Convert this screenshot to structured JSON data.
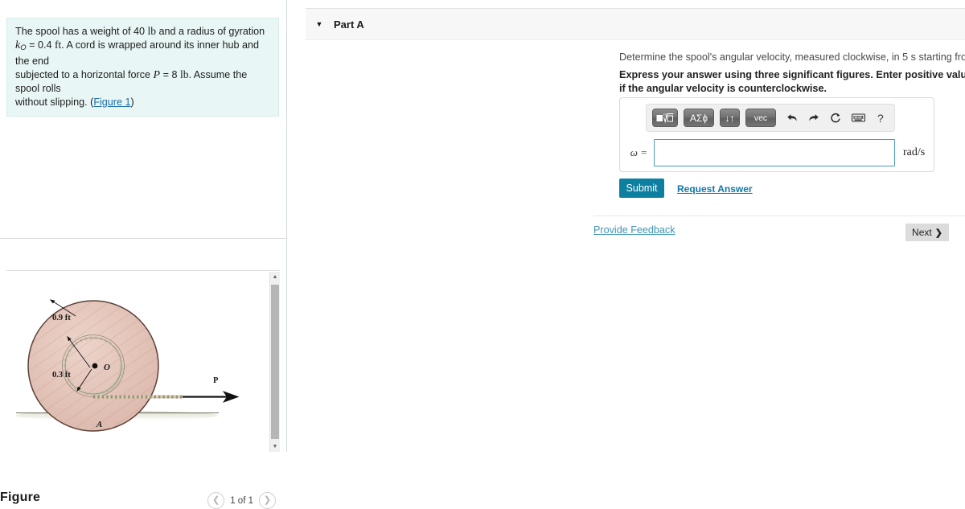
{
  "problem": {
    "line1_a": "The spool has a weight of 40",
    "line1_unit": "lb",
    "line1_b": "and a radius of gyration",
    "kvar": "k",
    "ksub": "O",
    "keq": "= 0.4",
    "kunit": "ft",
    "line2_b": ". A cord is wrapped around its inner hub and the end",
    "line3_a": "subjected to a horizontal force",
    "pvar": "P",
    "peq": "= 8",
    "punit": "lb",
    "line3_b": ". Assume the spool rolls",
    "line4_a": "without slipping. (",
    "figure_link": "Figure 1",
    "line4_b": ")"
  },
  "figure": {
    "title": "Figure",
    "counter": "1 of 1",
    "prev_icon": "chevron-left-icon",
    "next_icon": "chevron-right-icon",
    "outer_radius_label": "0.9 ft",
    "inner_radius_label": "0.3 ft",
    "center_label": "O",
    "force_label": "P",
    "contact_label": "A",
    "spool_fill": "#e3c3b8",
    "spool_stroke": "#5a4038"
  },
  "part": {
    "title": "Part A",
    "caret_icon": "caret-down-icon",
    "question": "Determine the spool's angular velocity, measured clockwise, in 5  s starting from rest.",
    "instruction": "Express your answer using three significant figures. Enter positive value if the angular velocity is clockwise and negative value if the angular velocity is counterclockwise."
  },
  "mathbar": {
    "buttons": [
      {
        "name": "template-root-button",
        "label": "■√□"
      },
      {
        "name": "greek-letters-button",
        "label": "ΑΣϕ"
      },
      {
        "name": "sub-superscript-button",
        "label": "↓↑"
      },
      {
        "name": "vector-button",
        "label": "vec"
      }
    ],
    "icons": [
      {
        "name": "undo-icon",
        "glyph": "↩"
      },
      {
        "name": "redo-icon",
        "glyph": "↪"
      },
      {
        "name": "reset-icon",
        "glyph": "↺"
      },
      {
        "name": "keyboard-icon",
        "glyph": "⌨"
      }
    ],
    "help_label": "?"
  },
  "answer": {
    "variable": "ω =",
    "value": "",
    "placeholder": "",
    "unit": "rad/s",
    "input_border_color": "#4a9cb5"
  },
  "actions": {
    "submit_label": "Submit",
    "request_answer_label": "Request Answer",
    "provide_feedback_label": "Provide Feedback",
    "next_label": "Next",
    "next_chevron": "❯",
    "submit_color": "#0d7fa0"
  }
}
